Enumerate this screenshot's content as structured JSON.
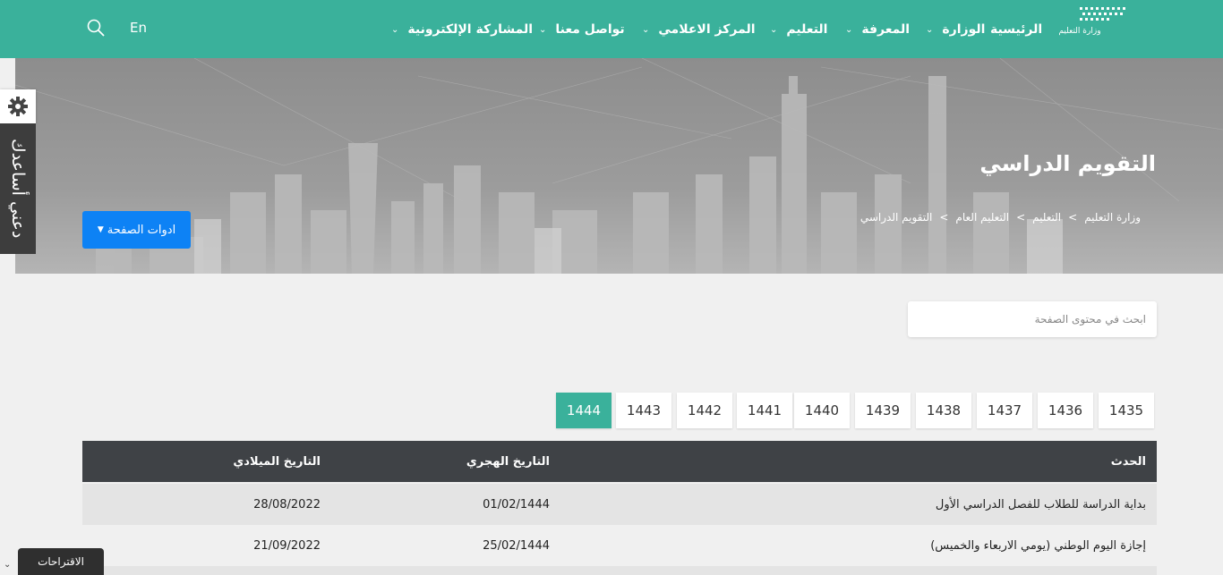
{
  "header": {
    "logo_text": "وزارة التعليم",
    "nav": [
      {
        "label": "الرئيسية",
        "has_menu": false
      },
      {
        "label": "الوزارة",
        "has_menu": true
      },
      {
        "label": "المعرفة",
        "has_menu": true
      },
      {
        "label": "التعليم",
        "has_menu": true
      },
      {
        "label": "المركز الاعلامي",
        "has_menu": true
      },
      {
        "label": "تواصل معنا",
        "has_menu": true
      },
      {
        "label": "المشاركة الإلكترونية",
        "has_menu": true
      }
    ],
    "lang": "En",
    "search_icon": "search-icon"
  },
  "hero": {
    "title": "التقويم الدراسي",
    "breadcrumb": [
      "وزارة التعليم",
      "التعليم",
      "التعليم العام",
      "التقويم الدراسي"
    ],
    "breadcrumb_sep": ">",
    "tools_label": "ادوات الصفحة"
  },
  "help": {
    "label": "دعني أساعدك",
    "gear_icon": "gear-icon"
  },
  "search": {
    "placeholder": "ابحث في محتوى الصفحة"
  },
  "years": [
    "1435",
    "1436",
    "1437",
    "1438",
    "1439",
    "1440",
    "1441",
    "1442",
    "1443",
    "1444"
  ],
  "active_year": "1444",
  "table": {
    "headers": {
      "event": "الحدث",
      "hijri": "التاريخ الهجري",
      "gregorian": "التاريخ الميلادي"
    },
    "rows": [
      {
        "event": "بداية الدراسة للطلاب للفصل الدراسي الأول",
        "hijri": "01/02/1444",
        "gregorian": "28/08/2022"
      },
      {
        "event": "إجازة اليوم الوطني (يومي الاربعاء والخميس)",
        "hijri": "25/02/1444",
        "gregorian": "21/09/2022"
      }
    ]
  },
  "suggestions_label": "الاقتراحات",
  "colors": {
    "brand": "#3ab19b",
    "button_blue": "#0d82f5",
    "table_header": "#3f4246"
  }
}
